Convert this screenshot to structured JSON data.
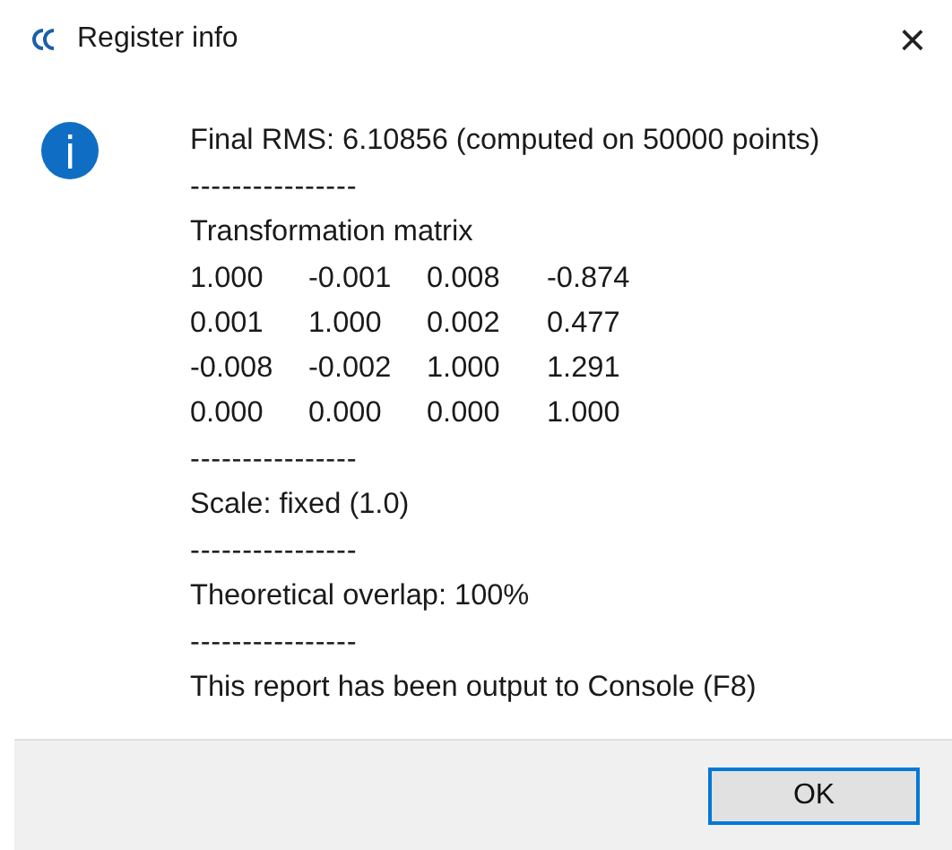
{
  "window": {
    "title": "Register info",
    "close": "×"
  },
  "report": [
    {
      "kind": "text",
      "text": "Final RMS: 6.10856 (computed on 50000 points)"
    },
    {
      "kind": "separator",
      "text": "----------------"
    },
    {
      "kind": "text",
      "text": "Transformation matrix"
    },
    {
      "kind": "matrix",
      "rows": [
        [
          "1.000",
          "-0.001",
          "0.008",
          "-0.874"
        ],
        [
          "0.001",
          "1.000",
          "0.002",
          "0.477"
        ],
        [
          "-0.008",
          "-0.002",
          "1.000",
          "1.291"
        ],
        [
          "0.000",
          "0.000",
          "0.000",
          "1.000"
        ]
      ]
    },
    {
      "kind": "separator",
      "text": "----------------"
    },
    {
      "kind": "text",
      "text": "Scale: fixed (1.0)"
    },
    {
      "kind": "separator",
      "text": "----------------"
    },
    {
      "kind": "text",
      "text": "Theoretical overlap: 100%"
    },
    {
      "kind": "separator",
      "text": "----------------"
    },
    {
      "kind": "text",
      "text": "This report has been output to Console (F8)"
    }
  ],
  "buttons": [
    "OK"
  ]
}
